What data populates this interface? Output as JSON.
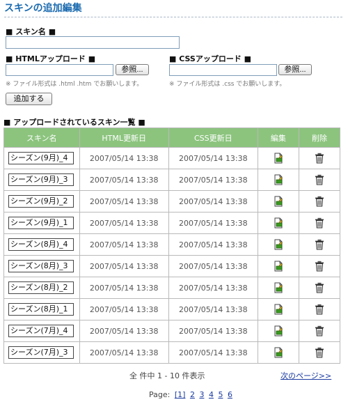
{
  "page": {
    "title": "スキンの追加編集"
  },
  "form": {
    "skin_name_label": "■ スキン名 ■",
    "skin_name_value": "",
    "html_upload_label": "■ HTMLアップロード ■",
    "html_file_value": "",
    "html_browse": "参照...",
    "html_note": "※ ファイル形式は .html .htm でお願いします。",
    "css_upload_label": "■ CSSアップロード ■",
    "css_file_value": "",
    "css_browse": "参照...",
    "css_note": "※ ファイル形式は .css でお願いします。",
    "add_button": "追加する"
  },
  "list": {
    "heading": "■ アップロードされているスキン一覧 ■",
    "columns": [
      "スキン名",
      "HTML更新日",
      "CSS更新日",
      "編集",
      "削除"
    ],
    "rows": [
      {
        "name": "シーズン(9月)_4",
        "html": "2007/05/14 13:38",
        "css": "2007/05/14 13:38"
      },
      {
        "name": "シーズン(9月)_3",
        "html": "2007/05/14 13:38",
        "css": "2007/05/14 13:38"
      },
      {
        "name": "シーズン(9月)_2",
        "html": "2007/05/14 13:38",
        "css": "2007/05/14 13:38"
      },
      {
        "name": "シーズン(9月)_1",
        "html": "2007/05/14 13:38",
        "css": "2007/05/14 13:38"
      },
      {
        "name": "シーズン(8月)_4",
        "html": "2007/05/14 13:38",
        "css": "2007/05/14 13:38"
      },
      {
        "name": "シーズン(8月)_3",
        "html": "2007/05/14 13:38",
        "css": "2007/05/14 13:38"
      },
      {
        "name": "シーズン(8月)_2",
        "html": "2007/05/14 13:38",
        "css": "2007/05/14 13:38"
      },
      {
        "name": "シーズン(8月)_1",
        "html": "2007/05/14 13:38",
        "css": "2007/05/14 13:38"
      },
      {
        "name": "シーズン(7月)_4",
        "html": "2007/05/14 13:38",
        "css": "2007/05/14 13:38"
      },
      {
        "name": "シーズン(7月)_3",
        "html": "2007/05/14 13:38",
        "css": "2007/05/14 13:38"
      }
    ],
    "edit_icon": "edit-document-icon",
    "delete_icon": "trash-icon",
    "count_text": "全 件中 1 - 10 件表示",
    "next_link": "次のページ>>"
  },
  "pager": {
    "label": "Page:",
    "pages": [
      "[1]",
      "2",
      "3",
      "4",
      "5",
      "6"
    ]
  },
  "colors": {
    "title": "#1a6ab0",
    "header_bg": "#8cc47e",
    "link": "#1a3aa0"
  }
}
